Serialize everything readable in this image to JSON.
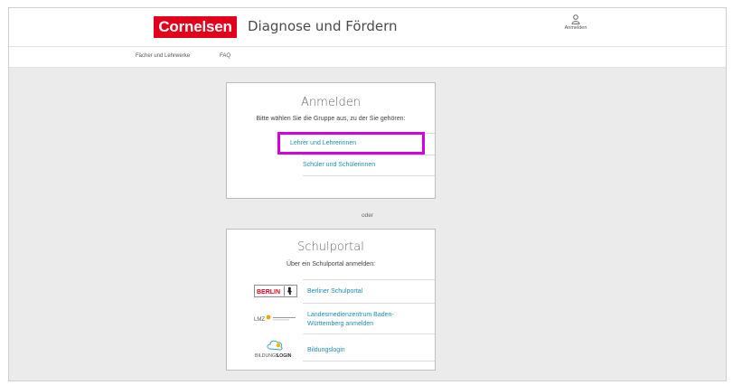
{
  "header": {
    "logo_text": "Cornelsen",
    "app_title": "Diagnose und Fördern",
    "login_label": "Anmelden"
  },
  "subnav": {
    "items": [
      "Fächer und Lehrwerke",
      "FAQ"
    ]
  },
  "login_card": {
    "title": "Anmelden",
    "subtitle": "Bitte wählen Sie die Gruppe aus, zu der Sie gehören:",
    "options": [
      "Lehrer und Lehrerinnen",
      "Schüler und Schülerinnen"
    ]
  },
  "separator": "oder",
  "portal_card": {
    "title": "Schulportal",
    "subtitle": "Über ein Schulportal anmelden:",
    "portals": [
      {
        "label": "Berliner Schulportal",
        "logo_text": "BERLIN"
      },
      {
        "label_line1": "Landesmedienzentrum Baden-",
        "label_line2": "Württemberg anmelden",
        "logo_text": "LMZ"
      },
      {
        "label": "Bildungslogin",
        "logo_text_a": "BILDUNGS",
        "logo_text_b": "LOGIN"
      }
    ]
  },
  "colors": {
    "brand_red": "#e2001a",
    "link_blue": "#1f8fb6",
    "highlight": "#d200e0",
    "page_bg": "#ebebeb"
  }
}
